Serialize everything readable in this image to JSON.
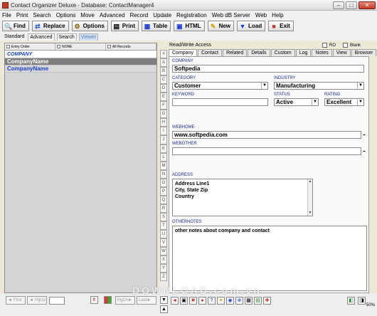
{
  "window": {
    "title": "Contact Organizer Deluxe - Database: ContactManager4"
  },
  "menu": [
    "File",
    "Print",
    "Search",
    "Options",
    "Move",
    "Advanced",
    "Record",
    "Update",
    "Registration",
    "Web dB Server",
    "Web",
    "Help"
  ],
  "toolbar": [
    {
      "label": "Find",
      "icon": "magnifier-icon"
    },
    {
      "label": "Replace",
      "icon": "replace-icon"
    },
    {
      "label": "Options",
      "icon": "options-icon"
    },
    {
      "label": "Print",
      "icon": "printer-icon"
    },
    {
      "label": "Table",
      "icon": "table-icon"
    },
    {
      "label": "HTML",
      "icon": "html-icon"
    },
    {
      "label": "New",
      "icon": "new-record-icon"
    },
    {
      "label": "Load",
      "icon": "load-icon"
    },
    {
      "label": "Exit",
      "icon": "exit-icon"
    }
  ],
  "modes": [
    "Standard",
    "Advanced",
    "Search",
    "Viewer"
  ],
  "list": {
    "filters": [
      "Entry Order",
      "NONE",
      "All Records"
    ],
    "column_header": "COMPANY",
    "rows": [
      "CompanyName",
      "CompanyName"
    ]
  },
  "letters": [
    "#",
    "A",
    "B",
    "C",
    "D",
    "E",
    "F",
    "G",
    "H",
    "I",
    "J",
    "K",
    "L",
    "M",
    "N",
    "O",
    "P",
    "Q",
    "R",
    "S",
    "T",
    "U",
    "V",
    "W",
    "X",
    "Y",
    "Z"
  ],
  "record": {
    "access": "Read/Write Access",
    "ro_label": "RO",
    "blank_label": "Blank",
    "tabs": [
      "Company",
      "Contact",
      "Related",
      "Details",
      "Custom",
      "Log",
      "Notes",
      "View",
      "Browser"
    ],
    "active_tab": "Company",
    "fields": {
      "company": {
        "label": "COMPANY",
        "value": "Softpedia"
      },
      "category": {
        "label": "CATEGORY",
        "value": "Customer"
      },
      "industry": {
        "label": "INDUSTRY",
        "value": "Manufacturing"
      },
      "keyword": {
        "label": "KEYWORD",
        "value": ""
      },
      "status": {
        "label": "STATUS",
        "value": "Active"
      },
      "rating": {
        "label": "RATING",
        "value": "Excellent"
      },
      "webhome": {
        "label": "WEBHOME",
        "value": "www.softpedia.com"
      },
      "webother": {
        "label": "WEBOTHER",
        "value": ""
      },
      "address": {
        "label": "ADDRESS",
        "lines": [
          "Address Line1",
          "City,   State   Zip",
          "Country"
        ]
      },
      "othernotes": {
        "label": "OTHERNOTES",
        "value": "other notes about company and contact"
      }
    }
  },
  "nav": {
    "first": "First",
    "pgup": "PgUp",
    "pgdn": "PgDn",
    "last": "Last",
    "zoom": "50%"
  },
  "watermark": "DOWNLOAD.com.vn"
}
